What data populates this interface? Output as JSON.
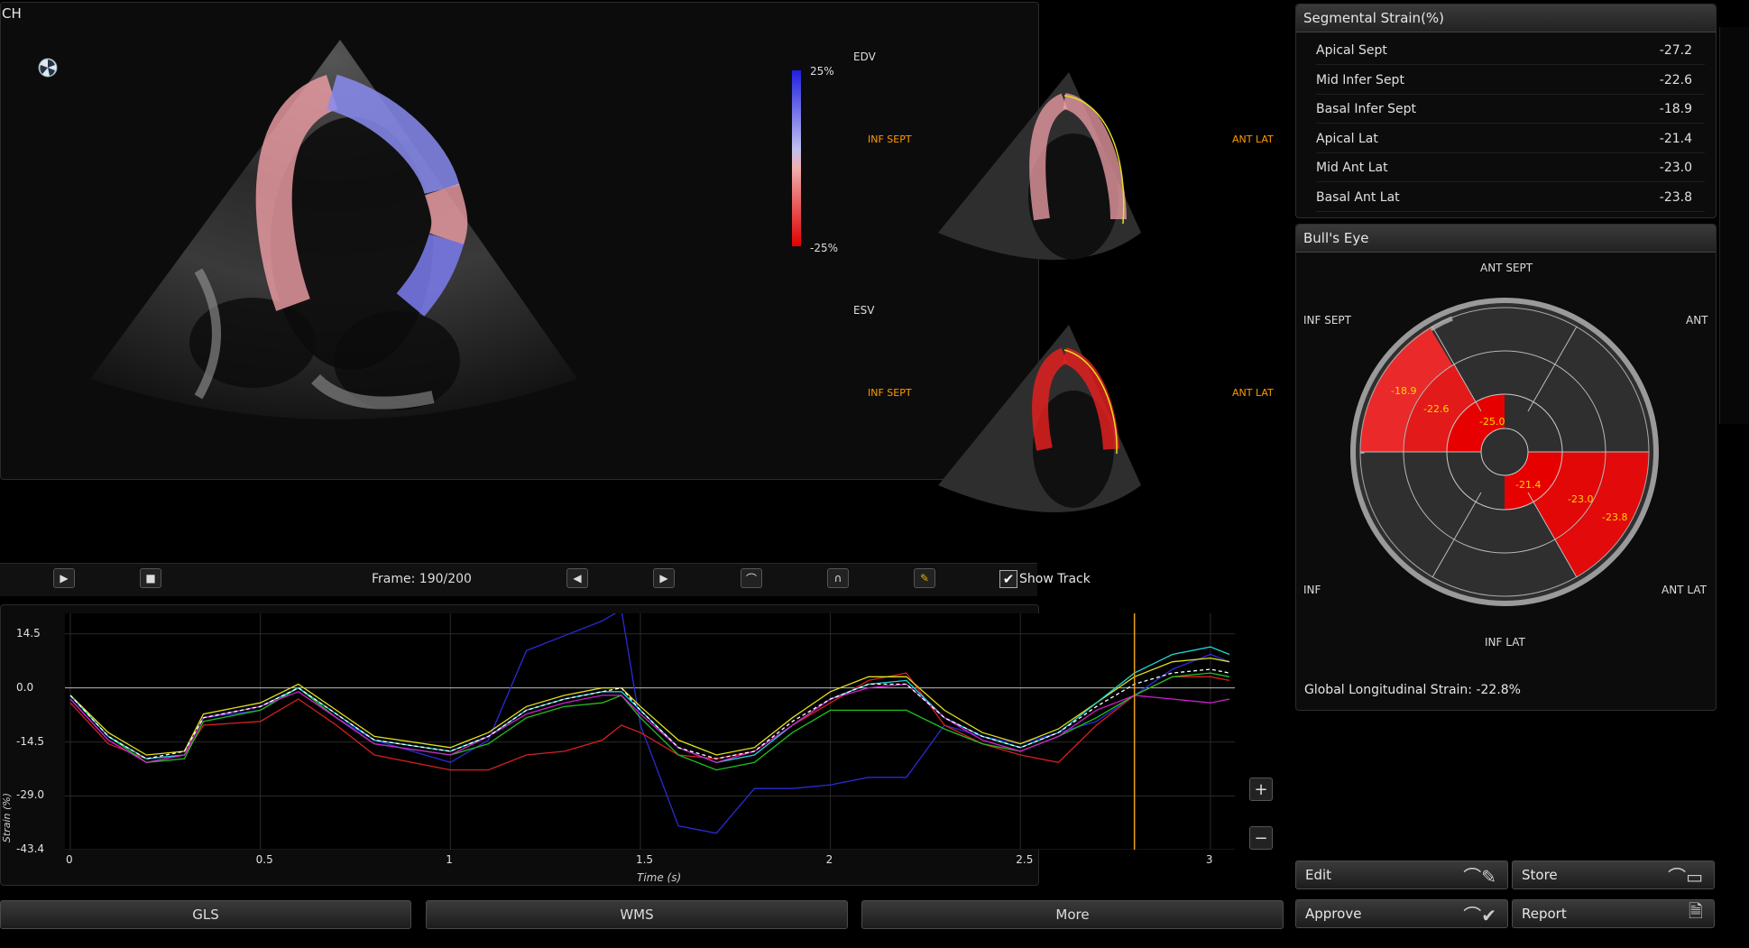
{
  "view_title": "CH",
  "colorbar": {
    "max": "25%",
    "min": "-25%"
  },
  "labels": {
    "edv": "EDV",
    "esv": "ESV",
    "inf_sept": "INF SEPT",
    "ant_lat": "ANT LAT"
  },
  "playback": {
    "frame": "Frame: 190/200",
    "show_track": "Show Track",
    "show_track_checked": true
  },
  "segmental_strain": {
    "title": "Segmental Strain(%)",
    "rows": [
      {
        "name": "Apical Sept",
        "value": "-27.2"
      },
      {
        "name": "Mid Infer Sept",
        "value": "-22.6"
      },
      {
        "name": "Basal Infer Sept",
        "value": "-18.9"
      },
      {
        "name": "Apical Lat",
        "value": "-21.4"
      },
      {
        "name": "Mid Ant Lat",
        "value": "-23.0"
      },
      {
        "name": "Basal Ant Lat",
        "value": "-23.8"
      }
    ]
  },
  "bulls_eye": {
    "title": "Bull's Eye",
    "top": "ANT SEPT",
    "top_left": "INF SEPT",
    "top_right": "ANT",
    "bottom_left": "INF",
    "bottom_right": "ANT LAT",
    "bottom": "INF LAT",
    "values": [
      "-18.9",
      "-22.6",
      "-25.0",
      "-21.4",
      "-23.0",
      "-23.8"
    ],
    "gls": "Global Longitudinal Strain: -22.8%"
  },
  "chart_data": {
    "type": "line",
    "xlabel": "Time (s)",
    "ylabel": "Strain (%)",
    "xlim": [
      0,
      3
    ],
    "ylim": [
      -43.4,
      20
    ],
    "x_ticks": [
      "0",
      "0.5",
      "1",
      "1.5",
      "2",
      "2.5",
      "3"
    ],
    "y_ticks": [
      "14.5",
      "0.0",
      "-14.5",
      "-29.0",
      "-43.4"
    ],
    "cursor_x": 2.8,
    "x": [
      0,
      0.1,
      0.2,
      0.3,
      0.35,
      0.5,
      0.6,
      0.7,
      0.8,
      1.0,
      1.1,
      1.2,
      1.3,
      1.4,
      1.45,
      1.5,
      1.6,
      1.7,
      1.8,
      1.9,
      2.0,
      2.1,
      2.2,
      2.3,
      2.4,
      2.5,
      2.6,
      2.7,
      2.8,
      2.9,
      3.0,
      3.05
    ],
    "series": [
      {
        "color": "#2b2bd6",
        "values": [
          -3,
          -14,
          -20,
          -18,
          -8,
          -6,
          0,
          -8,
          -14,
          -20,
          -14,
          10,
          14,
          18,
          21,
          -10,
          -37,
          -39,
          -27,
          -27,
          -26,
          -24,
          -24,
          -10,
          -13,
          -15,
          -12,
          -9,
          -2,
          5,
          9,
          7
        ]
      },
      {
        "color": "#d62020",
        "values": [
          -4,
          -15,
          -19,
          -18,
          -10,
          -9,
          -3,
          -10,
          -18,
          -22,
          -22,
          -18,
          -17,
          -14,
          -10,
          -12,
          -18,
          -19,
          -17,
          -10,
          -4,
          2,
          4,
          -10,
          -15,
          -18,
          -20,
          -10,
          -2,
          3,
          3,
          2
        ]
      },
      {
        "color": "#20c020",
        "values": [
          -2,
          -13,
          -20,
          -19,
          -9,
          -6,
          0,
          -8,
          -15,
          -18,
          -15,
          -8,
          -5,
          -4,
          -2,
          -8,
          -18,
          -22,
          -20,
          -12,
          -6,
          -6,
          -6,
          -11,
          -15,
          -17,
          -13,
          -8,
          -2,
          3,
          4,
          3
        ]
      },
      {
        "color": "#e0e020",
        "values": [
          -2,
          -12,
          -18,
          -17,
          -7,
          -4,
          1,
          -6,
          -13,
          -16,
          -12,
          -5,
          -2,
          0,
          0,
          -5,
          -14,
          -18,
          -16,
          -8,
          -1,
          3,
          3,
          -6,
          -12,
          -15,
          -11,
          -4,
          3,
          7,
          8,
          7
        ]
      },
      {
        "color": "#20d8d8",
        "values": [
          -2,
          -13,
          -19,
          -18,
          -8,
          -5,
          0,
          -7,
          -14,
          -17,
          -13,
          -6,
          -3,
          -1,
          -1,
          -6,
          -16,
          -20,
          -18,
          -10,
          -3,
          1,
          2,
          -8,
          -13,
          -16,
          -12,
          -4,
          4,
          9,
          11,
          9
        ]
      },
      {
        "color": "#d020d0",
        "values": [
          -3,
          -14,
          -20,
          -18,
          -8,
          -5,
          -1,
          -8,
          -15,
          -18,
          -13,
          -7,
          -4,
          -2,
          -2,
          -7,
          -16,
          -20,
          -17,
          -10,
          -3,
          0,
          1,
          -8,
          -14,
          -17,
          -13,
          -6,
          -2,
          -3,
          -4,
          -3
        ]
      },
      {
        "color": "#ffffff",
        "dashed": true,
        "values": [
          -2,
          -13,
          -19,
          -17,
          -8,
          -5,
          0,
          -7,
          -14,
          -17,
          -13,
          -6,
          -3,
          -1,
          0,
          -6,
          -16,
          -19,
          -17,
          -9,
          -3,
          1,
          1,
          -8,
          -13,
          -16,
          -12,
          -5,
          1,
          4,
          5,
          4
        ]
      }
    ]
  },
  "buttons": {
    "gls": "GLS",
    "wms": "WMS",
    "more": "More",
    "edit": "Edit",
    "store": "Store",
    "approve": "Approve",
    "report": "Report",
    "zoom_in": "+",
    "zoom_out": "−"
  }
}
